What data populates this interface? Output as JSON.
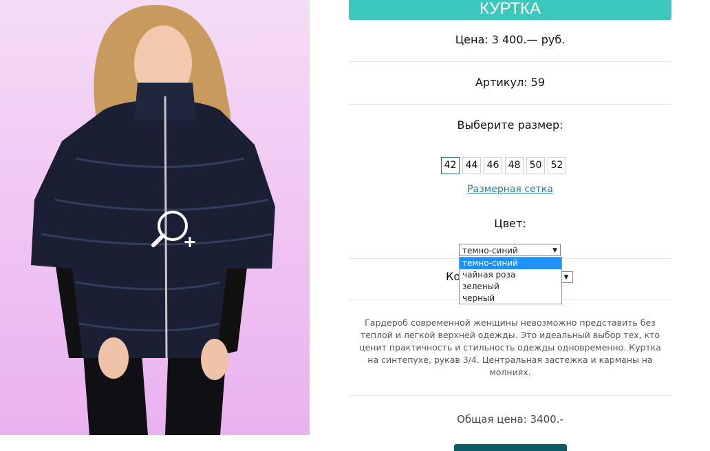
{
  "product": {
    "title": "КУРТКА",
    "price": "Цена: 3 400.— руб.",
    "article": "Артикул: 59",
    "choose_size_label": "Выберите размер:",
    "sizes": [
      "42",
      "44",
      "46",
      "48",
      "50",
      "52"
    ],
    "selected_size": "42",
    "size_chart_link": "Размерная сетка",
    "color_label": "Цвет:",
    "color_select": {
      "value": "темно-синий",
      "options": [
        "темно-синий",
        "чайная роза",
        "зеленый",
        "черный"
      ]
    },
    "quantity_label": "Ко",
    "description": "Гардероб современной женщины невозможно представить без теплой и легкой верхней одежды. Это идеальный выбор тех, кто ценит практичность и стильность одежды одновременно. Куртка на синтепухе, рукав 3/4. Центральная застежка и карманы на молниях.",
    "total": "Общая цена: 3400.-"
  },
  "colors": {
    "accent": "#3cc8be",
    "link": "#2a7a9a",
    "selection": "#1e90ff",
    "button": "#0b5a66"
  },
  "icons": {
    "zoom": "zoom-in-icon",
    "select_arrow": "dropdown-arrow-icon"
  }
}
